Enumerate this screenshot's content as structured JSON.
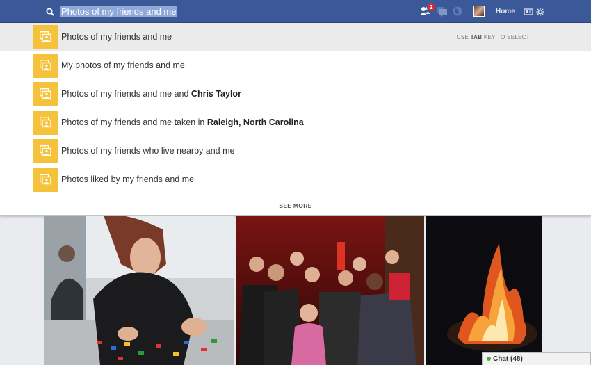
{
  "search": {
    "value": "Photos of my friends and me"
  },
  "nav": {
    "home_label": "Home",
    "friend_requests_count": "2"
  },
  "suggestions": [
    {
      "plain": "Photos of my friends and me",
      "bold": ""
    },
    {
      "plain": "My photos of my friends and me",
      "bold": ""
    },
    {
      "plain": "Photos of my friends and me and ",
      "bold": "Chris Taylor"
    },
    {
      "plain": "Photos of my friends and me taken in ",
      "bold": "Raleigh, North Carolina"
    },
    {
      "plain": "Photos of my friends who live nearby and me",
      "bold": ""
    },
    {
      "plain": "Photos liked by my friends and me",
      "bold": ""
    }
  ],
  "hint": {
    "prefix": "USE ",
    "key": "TAB",
    "suffix": " KEY TO SELECT"
  },
  "see_more_label": "SEE MORE",
  "chat": {
    "label": "Chat (48)"
  },
  "colors": {
    "topbar": "#3b5998",
    "suggestion_icon": "#f5c33b",
    "badge": "#e4252d"
  },
  "icons": [
    "search-icon",
    "friend-requests-icon",
    "messages-icon",
    "notifications-globe-icon",
    "privacy-shortcuts-icon",
    "settings-gear-icon",
    "photo-search-icon"
  ]
}
